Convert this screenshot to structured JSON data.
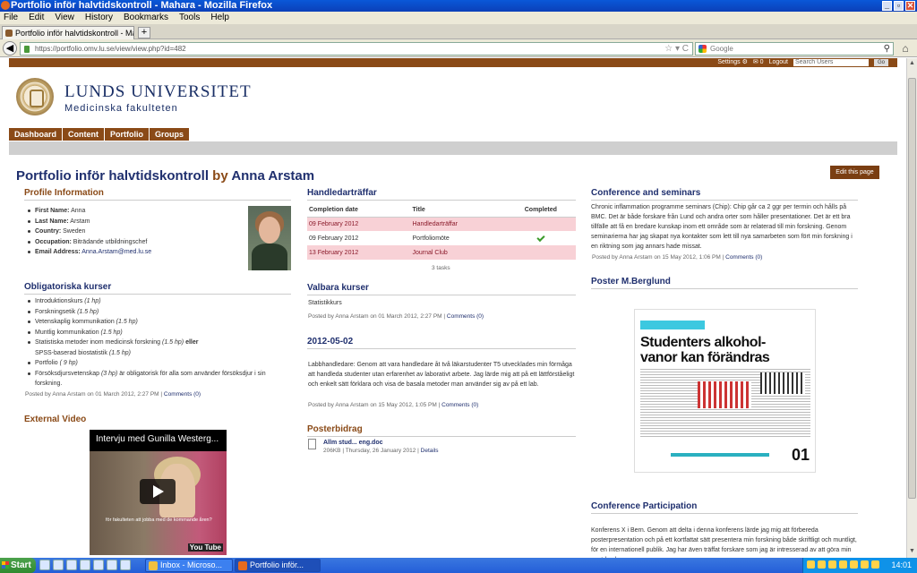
{
  "window": {
    "title": "Portfolio inför halvtidskontroll - Mahara - Mozilla Firefox",
    "buttons": [
      "_",
      "▫",
      "✕"
    ]
  },
  "menu": [
    "File",
    "Edit",
    "View",
    "History",
    "Bookmarks",
    "Tools",
    "Help"
  ],
  "tab": {
    "label": "Portfolio inför halvtidskontroll - Mahara",
    "new": "+"
  },
  "nav": {
    "url": "https://portfolio.omv.lu.se/view/view.php?id=482",
    "search_placeholder": "Google",
    "back": "◀",
    "star": "☆ ▾ C",
    "mag": "⚲",
    "home": "⌂"
  },
  "site": {
    "topbar": {
      "settings": "Settings ⚙",
      "inbox": "✉ 0",
      "logout": "Logout",
      "search_placeholder": "Search Users",
      "go": "Go"
    },
    "university": "LUNDS UNIVERSITET",
    "faculty": "Medicinska fakulteten",
    "tabs": [
      "Dashboard",
      "Content",
      "Portfolio",
      "Groups"
    ],
    "page_title": "Portfolio inför halvtidskontroll",
    "by": "by",
    "author": "Anna Arstam",
    "edit_button": "Edit this page"
  },
  "profile": {
    "heading": "Profile Information",
    "items": [
      {
        "label": "First Name:",
        "value": "Anna"
      },
      {
        "label": "Last Name:",
        "value": "Arstam"
      },
      {
        "label": "Country:",
        "value": "Sweden"
      },
      {
        "label": "Occupation:",
        "value": "Biträdande utbildningschef"
      },
      {
        "label": "Email Address:",
        "value": "Anna.Arstam@med.lu.se"
      }
    ]
  },
  "mandatory": {
    "heading": "Obligatoriska kurser",
    "items": [
      {
        "name": "Introduktionskurs",
        "credits": "(1 hp)"
      },
      {
        "name": "Forskningsetik",
        "credits": "(1.5 hp)"
      },
      {
        "name": "Vetenskaplig kommunikation",
        "credits": "(1.5 hp)"
      },
      {
        "name": "Muntlig kommunikation",
        "credits": "(1.5 hp)"
      },
      {
        "name": "Statistiska metoder inom medicinsk forskning",
        "credits": "(1.5 hp)",
        "extra": "eller",
        "line2": "SPSS-baserad biostatistik",
        "credits2": "(1.5 hp)"
      },
      {
        "name": "Portfolio",
        "credits": "( 9 hp)"
      },
      {
        "name": "Försöksdjursvetenskap",
        "credits": "(3 hp)",
        "suffix": "är obligatorisk för alla som använder försöksdjur i sin forskning."
      }
    ],
    "posted": "Posted by Anna Arstam on 01 March 2012, 2:27 PM |",
    "comments": "Comments (0)"
  },
  "video": {
    "heading": "External Video",
    "title": "Intervju med Gunilla Westerg...",
    "caption": "för fakulteten att jobba med de kommande åren?",
    "logo": "You Tube"
  },
  "tasks": {
    "heading": "Handledarträffar",
    "headers": [
      "Completion date",
      "Title",
      "Completed"
    ],
    "rows": [
      {
        "date": "09 February 2012",
        "title": "Handledarträffar",
        "done": false
      },
      {
        "date": "09 February 2012",
        "title": "Portfoliomöte",
        "done": true
      },
      {
        "date": "13 February 2012",
        "title": "Journal Club",
        "done": false
      }
    ],
    "count": "3 tasks"
  },
  "optional": {
    "heading": "Valbara kurser",
    "text": "Statistikkurs",
    "posted": "Posted by Anna Arstam on 01 March 2012, 2:27 PM |",
    "comments": "Comments (0)"
  },
  "entry": {
    "heading": "2012-05-02",
    "text": "Labbhandledare: Genom att vara handledare åt två läkarstudenter T5 utvecklades min förmåga att handleda studenter utan erfarenhet av laborativt arbete. Jag lärde mig att på ett lättförståeligt och enkelt sätt förklara och visa de basala metoder man använder sig av på ett lab.",
    "posted": "Posted by Anna Arstam on 15 May 2012, 1:05 PM |",
    "comments": "Comments (0)"
  },
  "poster_file": {
    "heading": "Posterbidrag",
    "name": "Allm stud... eng.doc",
    "meta": "206KB | Thursday, 26 January 2012 |",
    "details": "Details"
  },
  "conference": {
    "heading": "Conference and seminars",
    "text": "Chronic inflammation programme seminars (Chip): Chip går ca 2 ggr per termin och hålls på BMC. Det är både forskare från Lund och andra orter som håller presentationer. Det är ett bra tillfälle att få en bredare kunskap inom ett område som är relaterad till min forskning. Genom seminarierna har jag skapat nya kontakter som lett till nya samarbeten som fört min forskning i en riktning som jag annars hade missat.",
    "posted": "Posted by Anna Arstam on 15 May 2012, 1:06 PM |",
    "comments": "Comments (0)"
  },
  "poster": {
    "heading": "Poster M.Berglund",
    "title": "Studenters alkohol-vanor kan förändras",
    "number": "01"
  },
  "participation": {
    "heading": "Conference Participation",
    "text": "Konferens X i Bern. Genom att delta i denna konferens lärde jag mig att förbereda posterpresentation och på ett kortfattat sätt presentera min forskning både skriftligt och muntligt, för en internationell publik. Jag har även träffat forskare som jag är intresserad av att göra min postdoc hos."
  },
  "taskbar": {
    "start": "Start",
    "tasks": [
      {
        "label": "Inbox - Microso...",
        "color": "#f0c040"
      },
      {
        "label": "Portfolio inför...",
        "color": "#e56b1f"
      }
    ],
    "clock": "14:01"
  }
}
